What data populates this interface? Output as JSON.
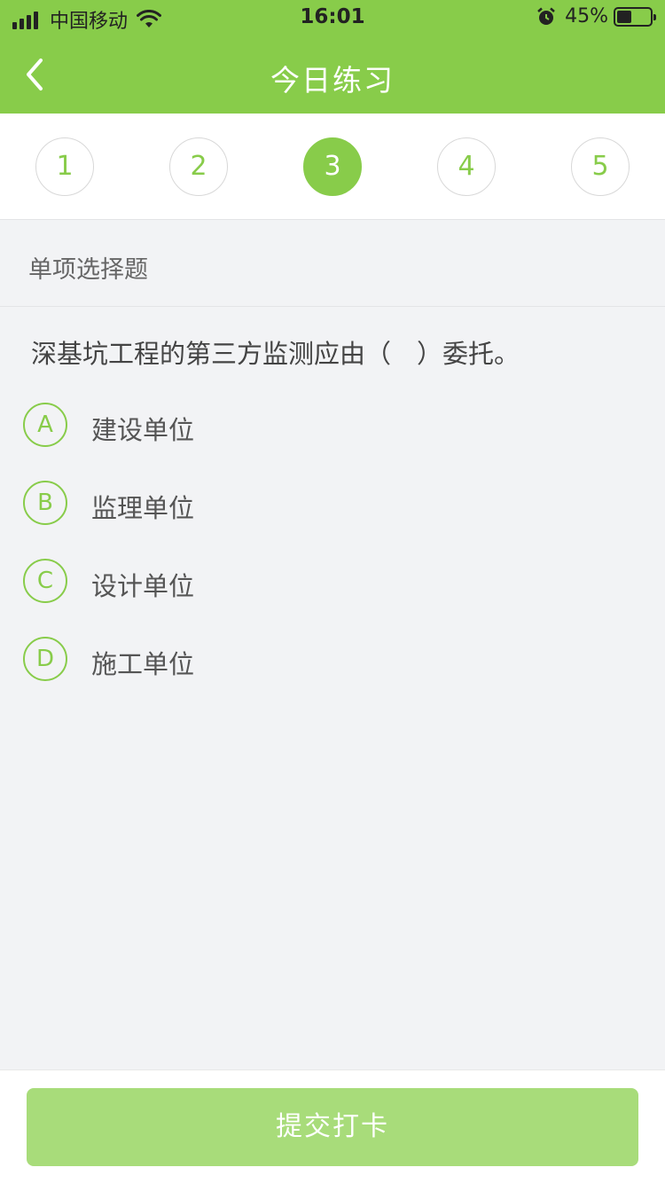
{
  "status_bar": {
    "carrier": "中国移动",
    "time": "16:01",
    "battery_percent": "45%",
    "battery_level": 0.45,
    "icons": [
      "signal-icon",
      "wifi-icon",
      "alarm-icon",
      "battery-icon"
    ]
  },
  "nav": {
    "title": "今日练习",
    "back_icon": "chevron-left-icon"
  },
  "steps": {
    "items": [
      "1",
      "2",
      "3",
      "4",
      "5"
    ],
    "active_index": 2
  },
  "question": {
    "type": "单项选择题",
    "text": "深基坑工程的第三方监测应由（　）委托。",
    "options": [
      {
        "letter": "A",
        "text": "建设单位"
      },
      {
        "letter": "B",
        "text": "监理单位"
      },
      {
        "letter": "C",
        "text": "设计单位"
      },
      {
        "letter": "D",
        "text": "施工单位"
      }
    ]
  },
  "footer": {
    "submit_label": "提交打卡"
  },
  "colors": {
    "accent": "#88cc4a",
    "accent_light": "#a8dc7a",
    "background": "#f2f3f5"
  }
}
